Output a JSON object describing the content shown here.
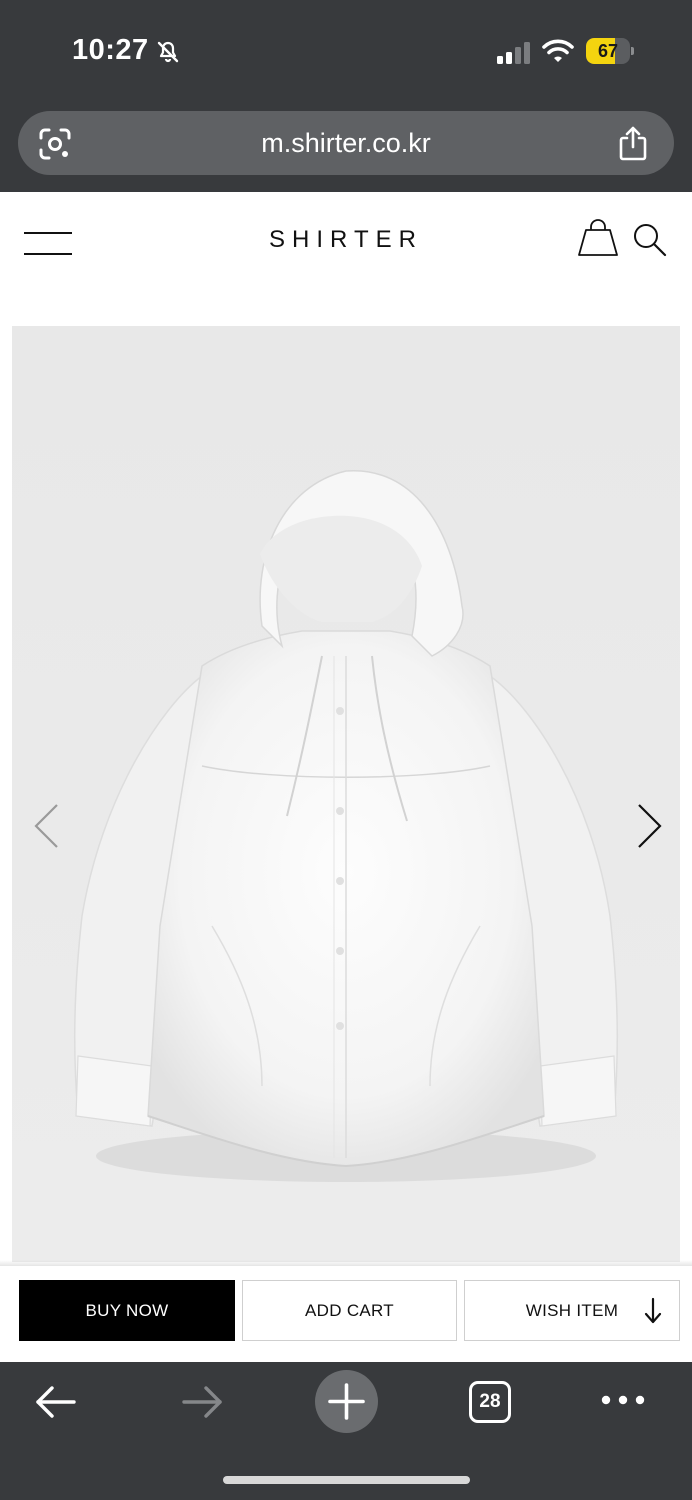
{
  "status_bar": {
    "time": "10:27",
    "battery_level": "67",
    "battery_fraction": 0.67,
    "battery_color": "#f4d40f",
    "icons": [
      "bell-slash-icon",
      "signal-icon",
      "wifi-icon",
      "battery-icon"
    ]
  },
  "browser": {
    "url": "m.shirter.co.kr",
    "tab_count": "28",
    "icons": [
      "lens-icon",
      "share-icon",
      "back-arrow-icon",
      "forward-arrow-icon",
      "plus-icon",
      "ellipsis-icon"
    ]
  },
  "header": {
    "logo": "SHIRTER",
    "icons": [
      "hamburger-menu-icon",
      "shopping-bag-icon",
      "search-icon"
    ]
  },
  "product": {
    "image": "white-hooded-shirt-jacket",
    "icons": [
      "chevron-left-icon",
      "chevron-right-icon"
    ]
  },
  "actions": {
    "buy_now": "BUY NOW",
    "add_cart": "ADD CART",
    "wish_item": "WISH ITEM"
  },
  "colors": {
    "chrome": "#383a3d",
    "buy_button": "#000000",
    "image_background": "#e9e9e9"
  }
}
